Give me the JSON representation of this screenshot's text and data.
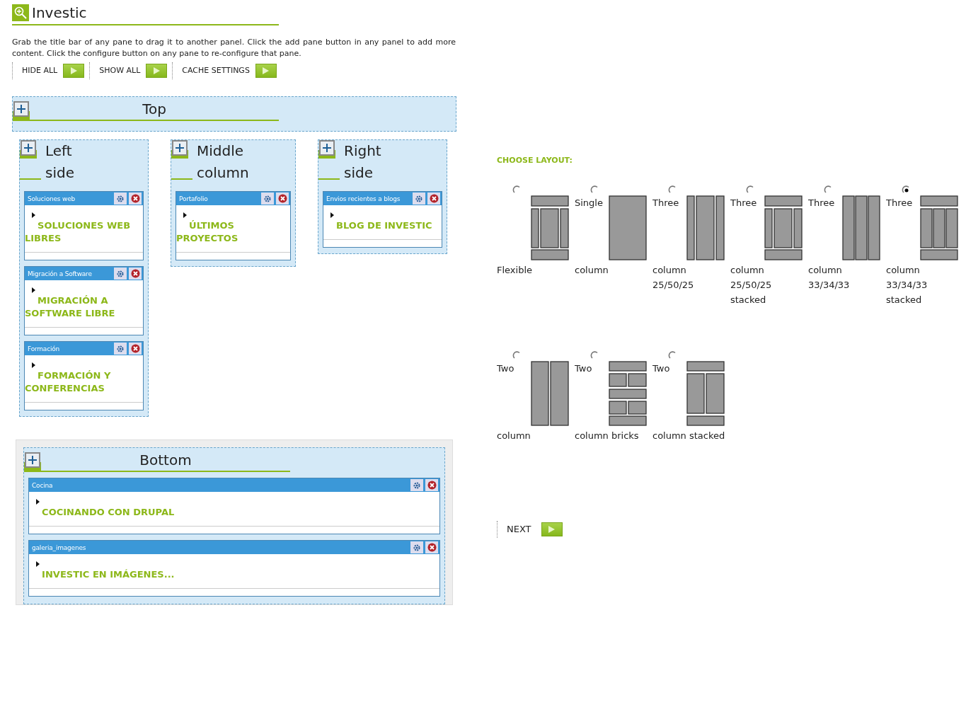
{
  "page_title": "Investic",
  "description": "Grab the title bar of any pane to drag it to another panel. Click the add pane button in any panel to add more content. Click the configure button on any pane to re-configure that pane.",
  "actions": [
    "HIDE ALL",
    "SHOW ALL",
    "CACHE SETTINGS"
  ],
  "top": {
    "title": "Top"
  },
  "columns": [
    {
      "title": "Left side",
      "panes": [
        {
          "title": "Soluciones web",
          "link": "SOLUCIONES WEB LIBRES"
        },
        {
          "title": "Migración a Software",
          "link": "MIGRACIÓN A SOFTWARE LIBRE"
        },
        {
          "title": "Formación",
          "link": "FORMACIÓN Y CONFERENCIAS"
        }
      ]
    },
    {
      "title": "Middle column",
      "panes": [
        {
          "title": "Portafolio",
          "link": "ÚLTIMOS PROYECTOS"
        }
      ]
    },
    {
      "title": "Right side",
      "panes": [
        {
          "title": "Envios recientes a blogs",
          "link": "BLOG DE INVESTIC"
        }
      ]
    }
  ],
  "bottom": {
    "title": "Bottom",
    "panes": [
      {
        "title": "Cocina",
        "link": "COCINANDO CON DRUPAL"
      },
      {
        "title": "galeria_imagenes",
        "link": "INVESTIC EN IMÁGENES..."
      }
    ]
  },
  "layout_chooser": {
    "heading": "CHOOSE LAYOUT:",
    "options": [
      {
        "kind": "flexible",
        "caption_lines": [
          "Flexible"
        ],
        "selected": false
      },
      {
        "kind": "single",
        "label_start": "Single",
        "caption_lines": [
          "column"
        ],
        "selected": false
      },
      {
        "kind": "three-25",
        "label_start": "Three",
        "caption_lines": [
          "column",
          "25/50/25"
        ],
        "selected": false
      },
      {
        "kind": "three-25-stacked",
        "label_start": "Three",
        "caption_lines": [
          "column",
          "25/50/25",
          "stacked"
        ],
        "selected": false
      },
      {
        "kind": "three-33",
        "label_start": "Three",
        "caption_lines": [
          "column",
          "33/34/33"
        ],
        "selected": false
      },
      {
        "kind": "three-33-stacked",
        "label_start": "Three",
        "caption_lines": [
          "column",
          "33/34/33",
          "stacked"
        ],
        "selected": true
      },
      {
        "kind": "two",
        "label_start": "Two",
        "caption_lines": [
          "column"
        ],
        "selected": false
      },
      {
        "kind": "two-bricks",
        "label_start": "Two",
        "caption_lines": [
          "column bricks"
        ],
        "selected": false
      },
      {
        "kind": "two-stacked",
        "label_start": "Two",
        "caption_lines": [
          "column stacked"
        ],
        "selected": false
      }
    ],
    "next_button": "NEXT"
  }
}
